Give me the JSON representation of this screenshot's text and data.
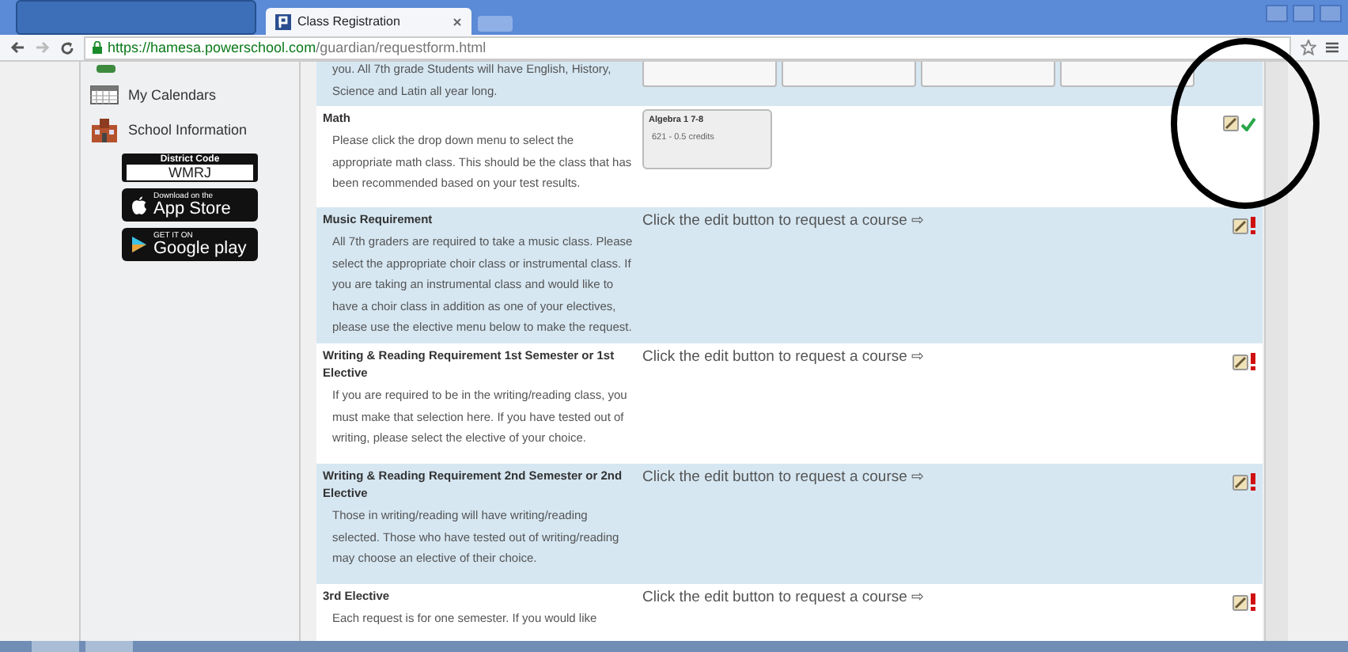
{
  "browser": {
    "tab_title": "Class Registration",
    "url_host": "https://hamesa.powerschool.com",
    "url_path": "/guardian/requestform.html"
  },
  "sidebar": {
    "items": [
      {
        "label": "My Calendars"
      },
      {
        "label": "School Information"
      }
    ],
    "district_code": {
      "title": "District Code",
      "code": "WMRJ"
    },
    "app_store": {
      "top": "Download on the",
      "name": "App Store"
    },
    "google_play": {
      "top": "GET IT ON",
      "name": "Google play"
    }
  },
  "intro": {
    "text": "you. All 7th grade Students will have English, History, Science and Latin all year long."
  },
  "requests": [
    {
      "title": "Math",
      "description": "Please click the drop down menu to select the appropriate math class. This should be the class that has been recommended based on your test results.",
      "course": {
        "name": "Algebra 1 7-8",
        "detail": "621 - 0.5 credits"
      },
      "complete": true
    },
    {
      "title": "Music Requirement",
      "description": "All 7th graders are required to take a music class. Please select the appropriate choir class or instrumental class. If you are taking an instrumental class and would like to have a choir class in addition as one of your electives, please use the elective menu below to make the request.",
      "prompt": "Click the edit button to request a course ⇨",
      "complete": false
    },
    {
      "title": "Writing & Reading Requirement 1st Semester or 1st Elective",
      "description": "If you are required to be in the writing/reading class, you must make that selection here. If you have tested out of writing, please select the elective of your choice.",
      "prompt": "Click the edit button to request a course ⇨",
      "complete": false
    },
    {
      "title": "Writing & Reading Requirement 2nd Semester or 2nd Elective",
      "description": "Those in writing/reading will have writing/reading selected. Those who have tested out of writing/reading may choose an elective of their choice.",
      "prompt": "Click the edit button to request a course ⇨",
      "complete": false
    },
    {
      "title": "3rd Elective",
      "description": "Each request is for one semester. If you would like",
      "prompt": "Click the edit button to request a course ⇨",
      "complete": false
    }
  ]
}
